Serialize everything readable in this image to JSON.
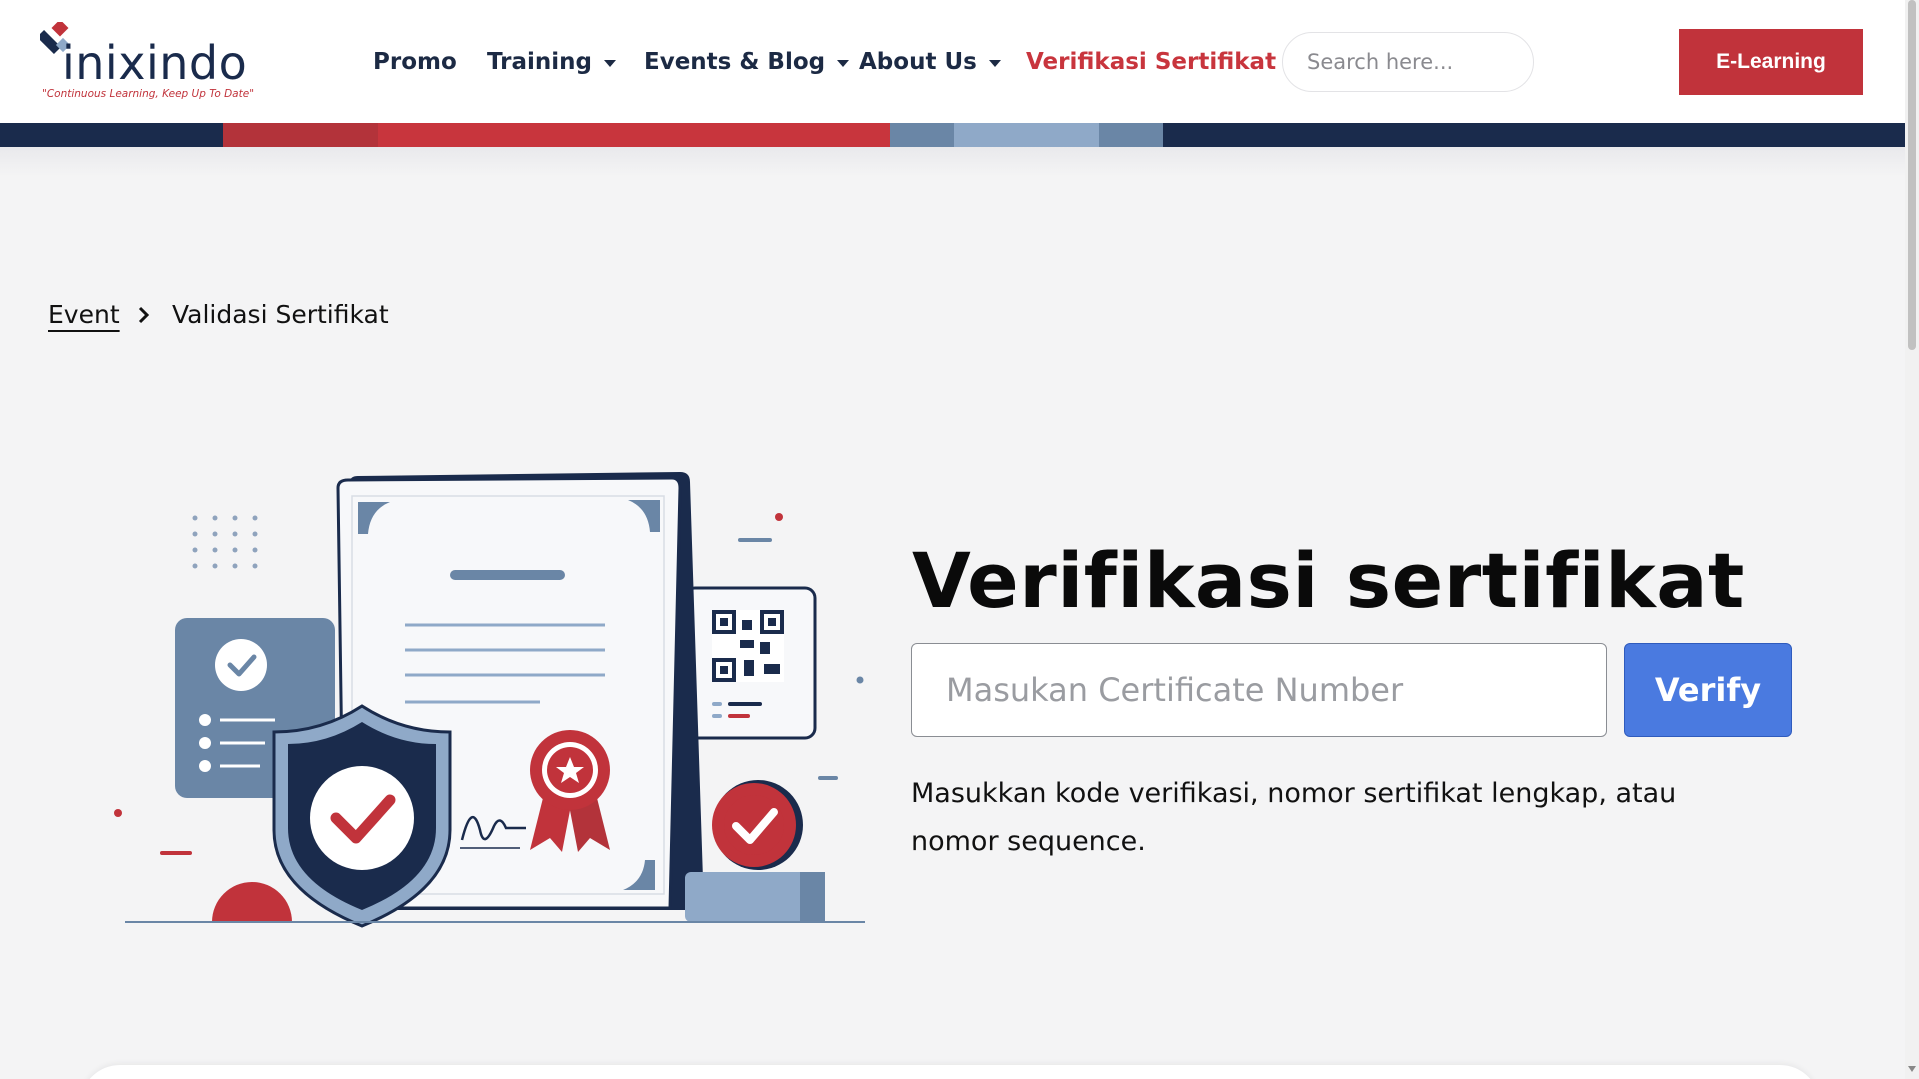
{
  "brand": {
    "name": "inixindo",
    "tagline": "\"Continuous Learning, Keep Up To Date\""
  },
  "nav": {
    "items": [
      {
        "label": "Promo",
        "dropdown": false,
        "active": false
      },
      {
        "label": "Training",
        "dropdown": true,
        "active": false
      },
      {
        "label": "Events & Blog",
        "dropdown": true,
        "active": false
      },
      {
        "label": "About Us",
        "dropdown": true,
        "active": false
      },
      {
        "label": "Verifikasi Sertifikat",
        "dropdown": false,
        "active": true
      }
    ],
    "search_placeholder": "Search here...",
    "elearning_label": "E-Learning"
  },
  "colors": {
    "brand_red": "#c1333b",
    "navy": "#1a2b4c",
    "verify_blue": "#4a7ae0",
    "stripe": [
      "#1a2b4c",
      "#b3333a",
      "#c8353d",
      "#6a86a6",
      "#8fa9c8",
      "#6a86a6",
      "#1a2b4c"
    ]
  },
  "breadcrumb": {
    "parent": "Event",
    "current": "Validasi Sertifikat"
  },
  "verify": {
    "title": "Verifikasi sertifikat",
    "input_placeholder": "Masukan Certificate Number",
    "input_value": "",
    "button_label": "Verify",
    "help_text": "Masukkan kode verifikasi, nomor sertifikat lengkap, atau nomor sequence."
  },
  "illustration": {
    "icons": [
      "certificate-icon",
      "shield-check-icon",
      "qr-code-icon",
      "ribbon-badge-icon",
      "checklist-card-icon",
      "check-seal-icon"
    ]
  }
}
